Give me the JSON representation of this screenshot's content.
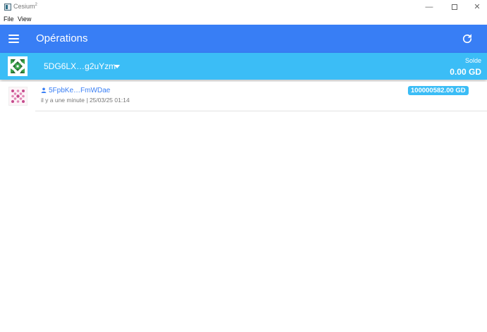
{
  "window": {
    "title": "Cesium",
    "title_sup": "2",
    "controls": {
      "minimize": "—",
      "maximize": "",
      "close": "✕"
    }
  },
  "menu": {
    "file": "File",
    "view": "View"
  },
  "header": {
    "menu_icon": "hamburger-menu-icon",
    "title": "Opérations",
    "refresh_icon": "refresh-icon",
    "color": "#387ef5"
  },
  "account": {
    "pubkey": "5DG6LX…g2uYzm",
    "balance_label": "Solde",
    "balance": "0.00 GD",
    "color": "#3bbdf6"
  },
  "transactions": [
    {
      "user_icon": "person-icon",
      "user": "5FpbKe…FmWDae",
      "meta": "il y a une minute | 25/03/25 01:14",
      "amount": "100000582.00 GD"
    }
  ]
}
